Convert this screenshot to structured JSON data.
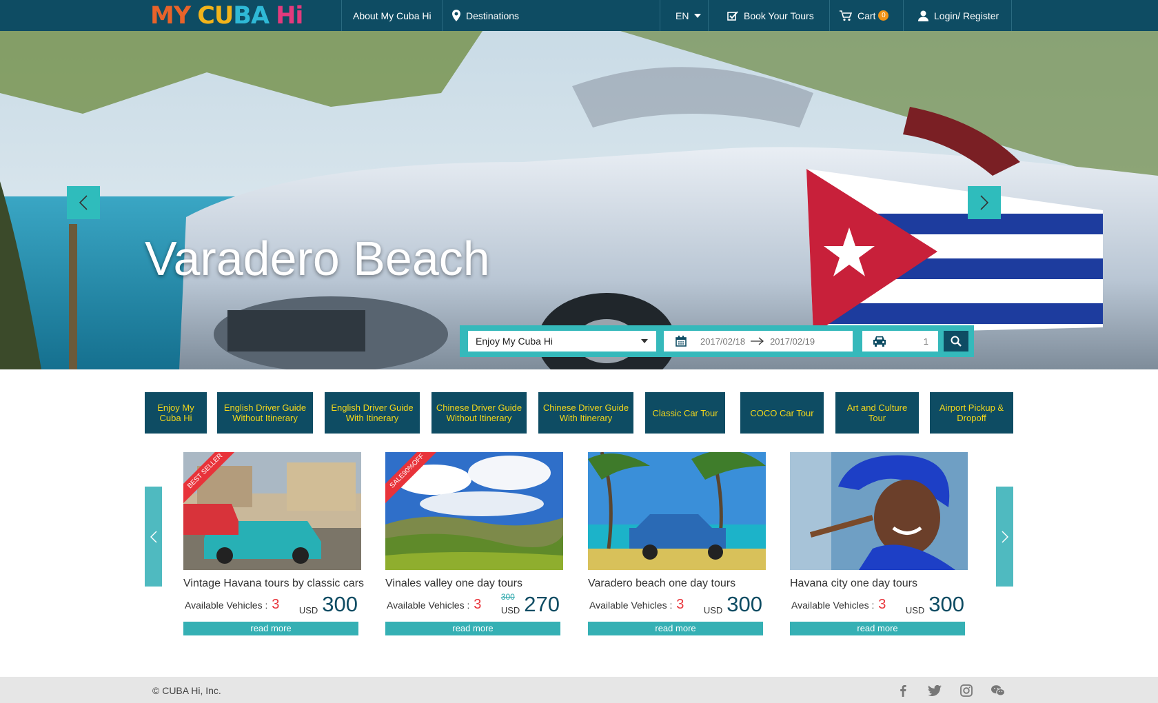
{
  "nav": {
    "logo_text": "MY CUBA Hi",
    "about": "About My Cuba Hi",
    "destinations": "Destinations",
    "language": "EN",
    "book": "Book Your Tours",
    "cart": "Cart",
    "cart_count": "0",
    "login": "Login/ Register"
  },
  "hero": {
    "title": "Varadero Beach",
    "search": {
      "tour": "Enjoy My Cuba Hi",
      "date_from": "2017/02/18",
      "date_to": "2017/02/19",
      "vehicles": "1"
    }
  },
  "categories": [
    "Enjoy My Cuba Hi",
    "English Driver Guide Without Itinerary",
    "English Driver Guide With Itinerary",
    "Chinese Driver Guide Without Itinerary",
    "Chinese Driver Guide With Itinerary",
    "Classic Car Tour",
    "COCO Car Tour",
    "Art and Culture Tour",
    "Airport Pickup & Dropoff"
  ],
  "tours": [
    {
      "title": "Vintage Havana tours by classic cars",
      "ribbon": "BEST SELLER",
      "avail_label": "Available Vehicles :",
      "vehicles": "3",
      "currency": "USD",
      "price": "300",
      "old_price": "",
      "button": "read more"
    },
    {
      "title": "Vinales valley one day tours",
      "ribbon": "SALE90%OFF",
      "avail_label": "Available Vehicles :",
      "vehicles": "3",
      "currency": "USD",
      "price": "270",
      "old_price": "300",
      "button": "read more"
    },
    {
      "title": "Varadero beach one day tours",
      "ribbon": "",
      "avail_label": "Available Vehicles :",
      "vehicles": "3",
      "currency": "USD",
      "price": "300",
      "old_price": "",
      "button": "read more"
    },
    {
      "title": "Havana city one day tours",
      "ribbon": "",
      "avail_label": "Available Vehicles :",
      "vehicles": "3",
      "currency": "USD",
      "price": "300",
      "old_price": "",
      "button": "read more"
    }
  ],
  "footer": {
    "copyright": "© CUBA Hi, Inc.",
    "social": [
      "facebook-icon",
      "twitter-icon",
      "instagram-icon",
      "wechat-icon"
    ]
  },
  "colors": {
    "nav_bg": "#0e4c63",
    "accent_teal": "#35b9bb",
    "category_text": "#f3d71a",
    "price_red": "#e8333a"
  }
}
